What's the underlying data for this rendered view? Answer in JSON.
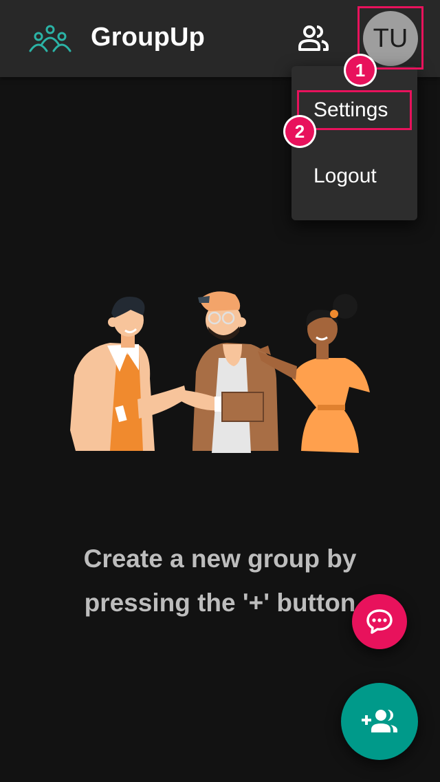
{
  "app": {
    "title": "GroupUp",
    "logo_icon": "group-logo-icon"
  },
  "header": {
    "people_icon": "people-icon",
    "avatar_initials": "TU"
  },
  "menu": {
    "items": [
      {
        "label": "Settings"
      },
      {
        "label": "Logout"
      }
    ]
  },
  "annotations": {
    "step1": "1",
    "step2": "2",
    "color": "#e8125c"
  },
  "main": {
    "illustration_icon": "three-people-illustration",
    "empty_line1": "Create a new group by",
    "empty_line2": "pressing the '+' button"
  },
  "fabs": {
    "chat_icon": "chat-bubble-icon",
    "chat_color": "#e8125c",
    "add_group_icon": "add-group-icon",
    "add_group_color": "#009a8a"
  }
}
